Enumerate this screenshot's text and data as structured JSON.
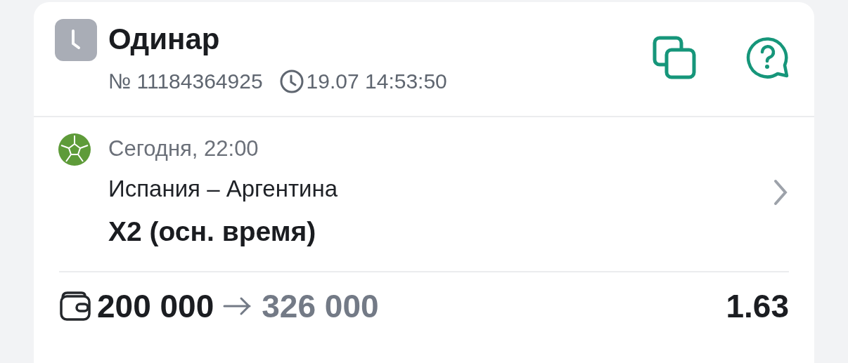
{
  "header": {
    "title": "Одинар",
    "number": "№ 11184364925",
    "datetime": "19.07 14:53:50"
  },
  "event": {
    "start": "Сегодня, 22:00",
    "teams": "Испания – Аргентина",
    "bet": "Х2 (осн. время)"
  },
  "footer": {
    "stake": "200 000",
    "payout": "326 000",
    "odds": "1.63"
  }
}
